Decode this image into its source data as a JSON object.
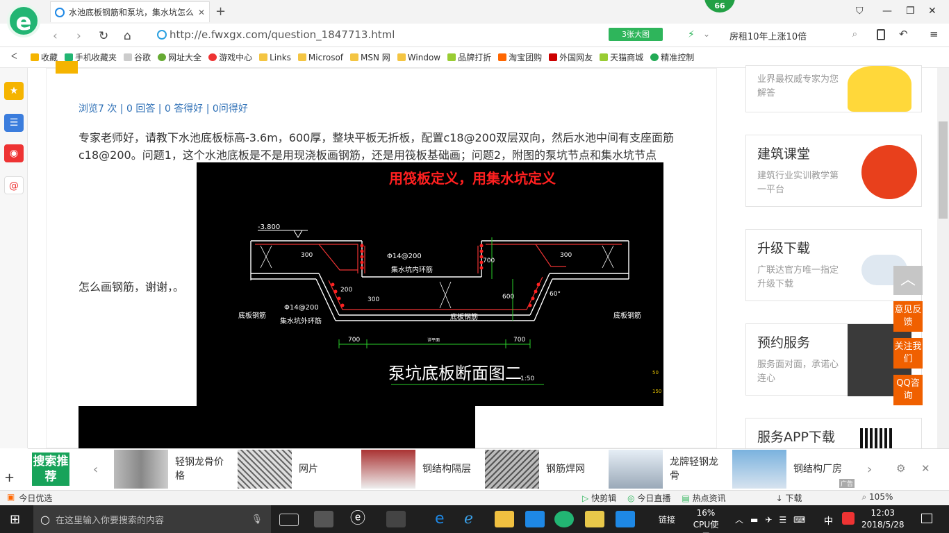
{
  "browser": {
    "tab_title": "水池底板钢筋和泵坑，集水坑怎么",
    "tab_close": "✕",
    "new_tab": "+",
    "badge": "66",
    "logo": "e",
    "url": "http://e.fwxgx.com/question_1847713.html",
    "big_image": "3张大图",
    "search_text": "房租10年上涨10倍",
    "min": "—",
    "max": "❐",
    "close": "✕",
    "nav_back": "‹",
    "nav_forward": "›",
    "nav_refresh": "↻",
    "nav_home": "⌂"
  },
  "bookmarks": [
    "收藏",
    "手机收藏夹",
    "谷歌",
    "网址大全",
    "游戏中心",
    "Links",
    "Microsof",
    "MSN 网",
    "Window",
    "品牌打折",
    "淘宝团购",
    "外国网友",
    "天猫商城",
    "精准控制"
  ],
  "question": {
    "stats": "浏览7 次 | 0 回答 | 0 答得好 | 0问得好",
    "body1": "专家老师好，请教下水池底板标高-3.6m，600厚，整块平板无折板，配置c18@200双层双向，然后水池中间有支座面筋c18@200。问题1，这个水池底板是不是用现浇板画钢筋，还是用筏板基础画；问题2，附图的泵坑节点和集水坑节点",
    "body2": "怎么画钢筋，谢谢，。"
  },
  "cad": {
    "red_title": "用筏板定义，用集水坑定义",
    "elev": "-3.800",
    "dim300a": "300",
    "dim300b": "300",
    "dim300c": "300",
    "dim200": "200",
    "dim700a": "700",
    "dim700b": "700",
    "dim700c": "700",
    "dim600": "600",
    "dim60": "60°",
    "rebar1": "Φ14@200",
    "rebar1_note": "集水坑内环筋",
    "rebar2": "Φ14@200",
    "rebar2_note": "集水坑外环筋",
    "bottom_a": "底板钢筋",
    "bottom_b": "底板钢筋",
    "bottom_c": "底板钢筋",
    "section": "泵坑底板断面图二",
    "scale": "1:50",
    "width_note": "详平面",
    "dim50": "50",
    "dim150": "150"
  },
  "sidebar": [
    {
      "title": "",
      "sub": "业界最权威专家为您解答"
    },
    {
      "title": "建筑课堂",
      "sub": "建筑行业实训教学第一平台"
    },
    {
      "title": "升级下载",
      "sub": "广联达官方唯一指定升级下载"
    },
    {
      "title": "预约服务",
      "sub": "服务面对面，承诺心连心"
    },
    {
      "title": "服务APP下载",
      "sub": ""
    }
  ],
  "float_buttons": [
    "意见反馈",
    "关注我们",
    "QQ咨询"
  ],
  "search_recommend": {
    "label": "搜索推荐",
    "items": [
      "轻钢龙骨价格",
      "网片",
      "钢结构隔层",
      "钢筋焊网",
      "龙牌轻钢龙骨",
      "钢结构厂房"
    ],
    "ad": "广告"
  },
  "statusbar": {
    "left": "今日优选",
    "items": [
      "快剪辑",
      "今日直播",
      "热点资讯",
      "下载",
      "105%"
    ]
  },
  "taskbar": {
    "search_placeholder": "在这里输入你要搜索的内容",
    "link": "链接",
    "cpu": "16%",
    "cpu_label": "CPU使用",
    "ime": "中",
    "time": "12:03",
    "date": "2018/5/28"
  }
}
